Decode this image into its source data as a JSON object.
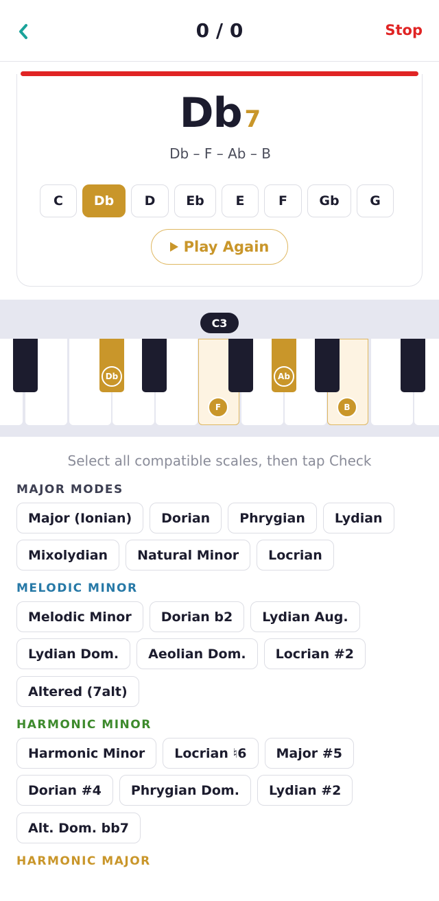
{
  "header": {
    "score": "0 / 0",
    "stop_label": "Stop",
    "back_icon": "chevron-left-icon"
  },
  "colors": {
    "accent": "#c9962a",
    "stop": "#e02424",
    "back": "#1aa39a",
    "melodic": "#2779a7",
    "harmonic_minor": "#3d8a2c",
    "harmonic_major": "#c9962a",
    "major_modes": "#3d3f52"
  },
  "chord": {
    "root": "Db",
    "quality": "7",
    "notes": "Db – F – Ab – B"
  },
  "roots": [
    {
      "label": "C",
      "selected": false
    },
    {
      "label": "Db",
      "selected": true
    },
    {
      "label": "D",
      "selected": false
    },
    {
      "label": "Eb",
      "selected": false
    },
    {
      "label": "E",
      "selected": false
    },
    {
      "label": "F",
      "selected": false
    },
    {
      "label": "Gb",
      "selected": false
    },
    {
      "label": "G",
      "selected": false
    }
  ],
  "play_label": "Play Again",
  "piano": {
    "octave_label": "C3",
    "notes": {
      "db": "Db",
      "f": "F",
      "ab": "Ab",
      "b": "B"
    }
  },
  "instruction": "Select all compatible scales, then tap Check",
  "sections": {
    "major_modes": {
      "title": "MAJOR MODES",
      "chips": [
        "Major (Ionian)",
        "Dorian",
        "Phrygian",
        "Lydian",
        "Mixolydian",
        "Natural Minor",
        "Locrian"
      ]
    },
    "melodic_minor": {
      "title": "MELODIC MINOR",
      "chips": [
        "Melodic Minor",
        "Dorian b2",
        "Lydian Aug.",
        "Lydian Dom.",
        "Aeolian Dom.",
        "Locrian #2",
        "Altered (7alt)"
      ]
    },
    "harmonic_minor": {
      "title": "HARMONIC MINOR",
      "chips": [
        "Harmonic Minor",
        "Locrian ♮6",
        "Major #5",
        "Dorian #4",
        "Phrygian Dom.",
        "Lydian #2",
        "Alt. Dom. bb7"
      ]
    },
    "harmonic_major": {
      "title": "HARMONIC MAJOR"
    }
  }
}
